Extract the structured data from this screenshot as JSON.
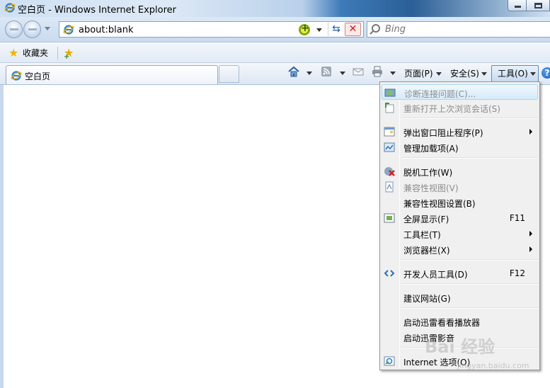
{
  "window": {
    "title": "空白页 - Windows Internet Explorer"
  },
  "address": {
    "url": "about:blank"
  },
  "search": {
    "placeholder": "Bing"
  },
  "favorites_bar": {
    "favorites_label": "收藏夹"
  },
  "tab": {
    "label": "空白页"
  },
  "command_bar": {
    "page_label": "页面(P)",
    "safety_label": "安全(S)",
    "tools_label": "工具(O)"
  },
  "tools_menu": {
    "items": [
      {
        "label": "诊断连接问题(C)...",
        "enabled": false,
        "icon": "diagnose-icon"
      },
      {
        "label": "重新打开上次浏览会话(S)",
        "enabled": false,
        "icon": "reopen-session-icon"
      },
      {
        "label": "弹出窗口阻止程序(P)",
        "enabled": true,
        "submenu": true,
        "icon": "popup-blocker-icon"
      },
      {
        "label": "管理加载项(A)",
        "enabled": true,
        "icon": "addons-icon"
      },
      {
        "label": "脱机工作(W)",
        "enabled": true,
        "icon": "offline-icon"
      },
      {
        "label": "兼容性视图(V)",
        "enabled": false,
        "icon": "compat-view-icon"
      },
      {
        "label": "兼容性视图设置(B)",
        "enabled": true
      },
      {
        "label": "全屏显示(F)",
        "enabled": true,
        "shortcut": "F11",
        "icon": "fullscreen-icon"
      },
      {
        "label": "工具栏(T)",
        "enabled": true,
        "submenu": true
      },
      {
        "label": "浏览器栏(X)",
        "enabled": true,
        "submenu": true
      },
      {
        "label": "开发人员工具(D)",
        "enabled": true,
        "shortcut": "F12",
        "icon": "dev-tools-icon"
      },
      {
        "label": "建议网站(G)",
        "enabled": true
      },
      {
        "label": "启动迅雷看看播放器",
        "enabled": true
      },
      {
        "label": "启动迅雷影音",
        "enabled": true
      },
      {
        "label": "Internet 选项(O)",
        "enabled": true,
        "icon": "internet-options-icon"
      }
    ]
  },
  "watermark": {
    "text": "Bai 经验",
    "subtext": "jingyan.baidu.com"
  },
  "colors": {
    "menu_hover": "#d5ebfa",
    "disabled_text": "#8d8d8d",
    "content_border": "#c8d9ee"
  }
}
